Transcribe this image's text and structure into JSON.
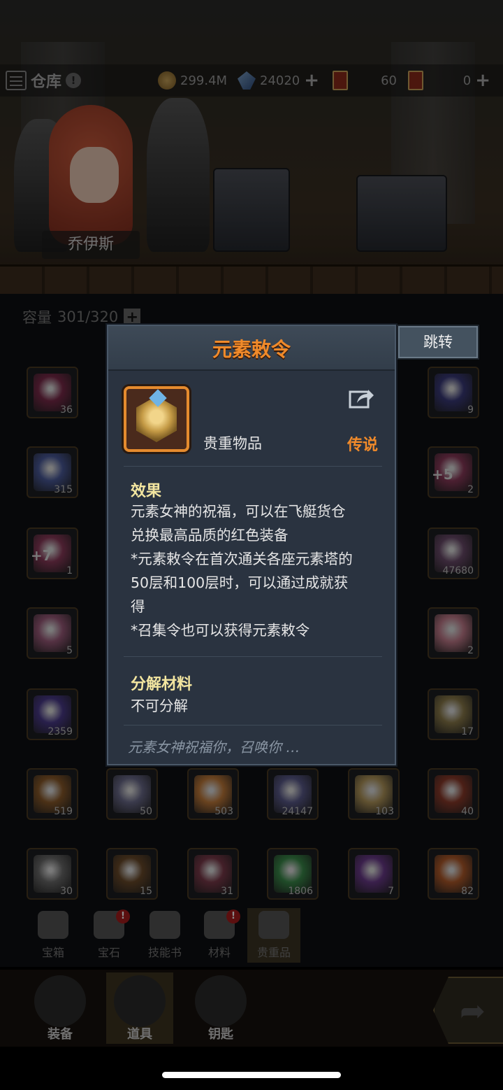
{
  "header": {
    "title": "仓库",
    "gold": "299.4M",
    "crystal": "24020",
    "ticket_a": "60",
    "ticket_b": "0"
  },
  "character": {
    "name": "乔伊斯"
  },
  "inventory": {
    "capacity_label": "容量",
    "capacity_value": "301/320",
    "slots": [
      {
        "count": "36",
        "color": "#7a2a4a"
      },
      {
        "count": "9",
        "color": "#3a3a7a"
      },
      {
        "count": "315",
        "color": "#4a5a9a"
      },
      {
        "count": "2",
        "bonus": "+5",
        "color": "#8a3a5a"
      },
      {
        "count": "1",
        "bonus": "+7",
        "color": "#8a3a5a"
      },
      {
        "count": "47680",
        "color": "#6a4a6a"
      },
      {
        "count": "5",
        "color": "#9a5a7a"
      },
      {
        "count": "2",
        "color": "#c07a8a"
      },
      {
        "count": "2359",
        "color": "#4a3a8a"
      },
      {
        "count": "17",
        "color": "#8a7a4a"
      },
      {
        "count": "519",
        "color": "#8a5a2a"
      },
      {
        "count": "50",
        "color": "#6a6a8a"
      },
      {
        "count": "503",
        "color": "#c07a3a"
      },
      {
        "count": "24147",
        "color": "#5a5a8a"
      },
      {
        "count": "103",
        "color": "#b0955a"
      },
      {
        "count": "40",
        "color": "#8a3a2a"
      },
      {
        "count": "30",
        "color": "#6a6a6a"
      },
      {
        "count": "15",
        "color": "#6a4a2a"
      },
      {
        "count": "31",
        "color": "#7a3a4a"
      },
      {
        "count": "1806",
        "color": "#3a8a4a"
      },
      {
        "count": "7",
        "color": "#6a3a8a"
      },
      {
        "count": "82",
        "color": "#b05a2a"
      }
    ]
  },
  "categories": [
    {
      "label": "宝箱",
      "badge": ""
    },
    {
      "label": "宝石",
      "badge": "!"
    },
    {
      "label": "技能书",
      "badge": ""
    },
    {
      "label": "材料",
      "badge": "!"
    },
    {
      "label": "贵重品",
      "badge": ""
    }
  ],
  "bottom_nav": [
    {
      "label": "装备"
    },
    {
      "label": "道具"
    },
    {
      "label": "钥匙"
    }
  ],
  "modal": {
    "title": "元素敕令",
    "item_type": "贵重物品",
    "rarity": "传说",
    "effect_title": "效果",
    "effect_lines": [
      "元素女神的祝福，可以在飞艇货仓",
      "兑换最高品质的红色装备",
      "*元素敕令在首次通关各座元素塔的",
      "50层和100层时，可以通过成就获",
      "得",
      "*召集令也可以获得元素敕令"
    ],
    "decompose_title": "分解材料",
    "decompose_value": "不可分解",
    "flavor": "元素女神祝福你，召唤你 …",
    "jump_label": "跳转"
  },
  "colors": {
    "legendary": "#f08a2a",
    "section_title": "#f3e6a0",
    "modal_bg": "#2a3340"
  }
}
